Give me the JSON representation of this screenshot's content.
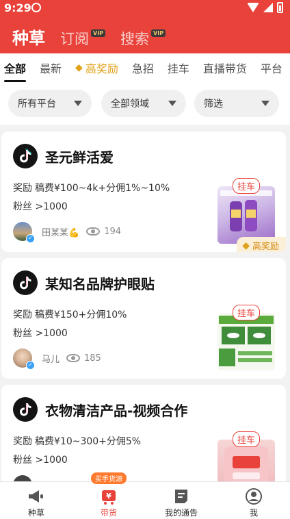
{
  "status": {
    "time": "9:29"
  },
  "header": {
    "tabs": [
      {
        "label": "种草",
        "vip": ""
      },
      {
        "label": "订阅",
        "vip": "VIP"
      },
      {
        "label": "搜索",
        "vip": "VIP"
      }
    ]
  },
  "categories": [
    "全部",
    "最新",
    "高奖励",
    "急招",
    "挂车",
    "直播带货",
    "平台"
  ],
  "filters": [
    "所有平台",
    "全部领域",
    "筛选"
  ],
  "cards": [
    {
      "title": "圣元鲜活爱",
      "reward_label": "奖励",
      "reward": "稿费¥100~4k+分佣1%~10%",
      "fans": "粉丝 >1000",
      "user": "田某某💪",
      "views": "194",
      "tag": "挂车",
      "prize": "高奖励"
    },
    {
      "title": "某知名品牌护眼贴",
      "reward_label": "奖励",
      "reward": "稿费¥150+分佣10%",
      "fans": "粉丝 >1000",
      "user": "马儿",
      "views": "185",
      "tag": "挂车",
      "prize": ""
    },
    {
      "title": "衣物清洁产品-视频合作",
      "reward_label": "奖励",
      "reward": "稿费¥10~300+分佣5%",
      "fans": "粉丝 >1000",
      "user": "",
      "views": "",
      "tag": "挂车",
      "prize": ""
    }
  ],
  "bottom_nav": {
    "items": [
      "种草",
      "带货",
      "我的通告",
      "我"
    ],
    "badge": "买手货源",
    "cart_symbol": "¥"
  },
  "colors": {
    "brand": "#e8423a",
    "gold": "#e0a21b"
  }
}
